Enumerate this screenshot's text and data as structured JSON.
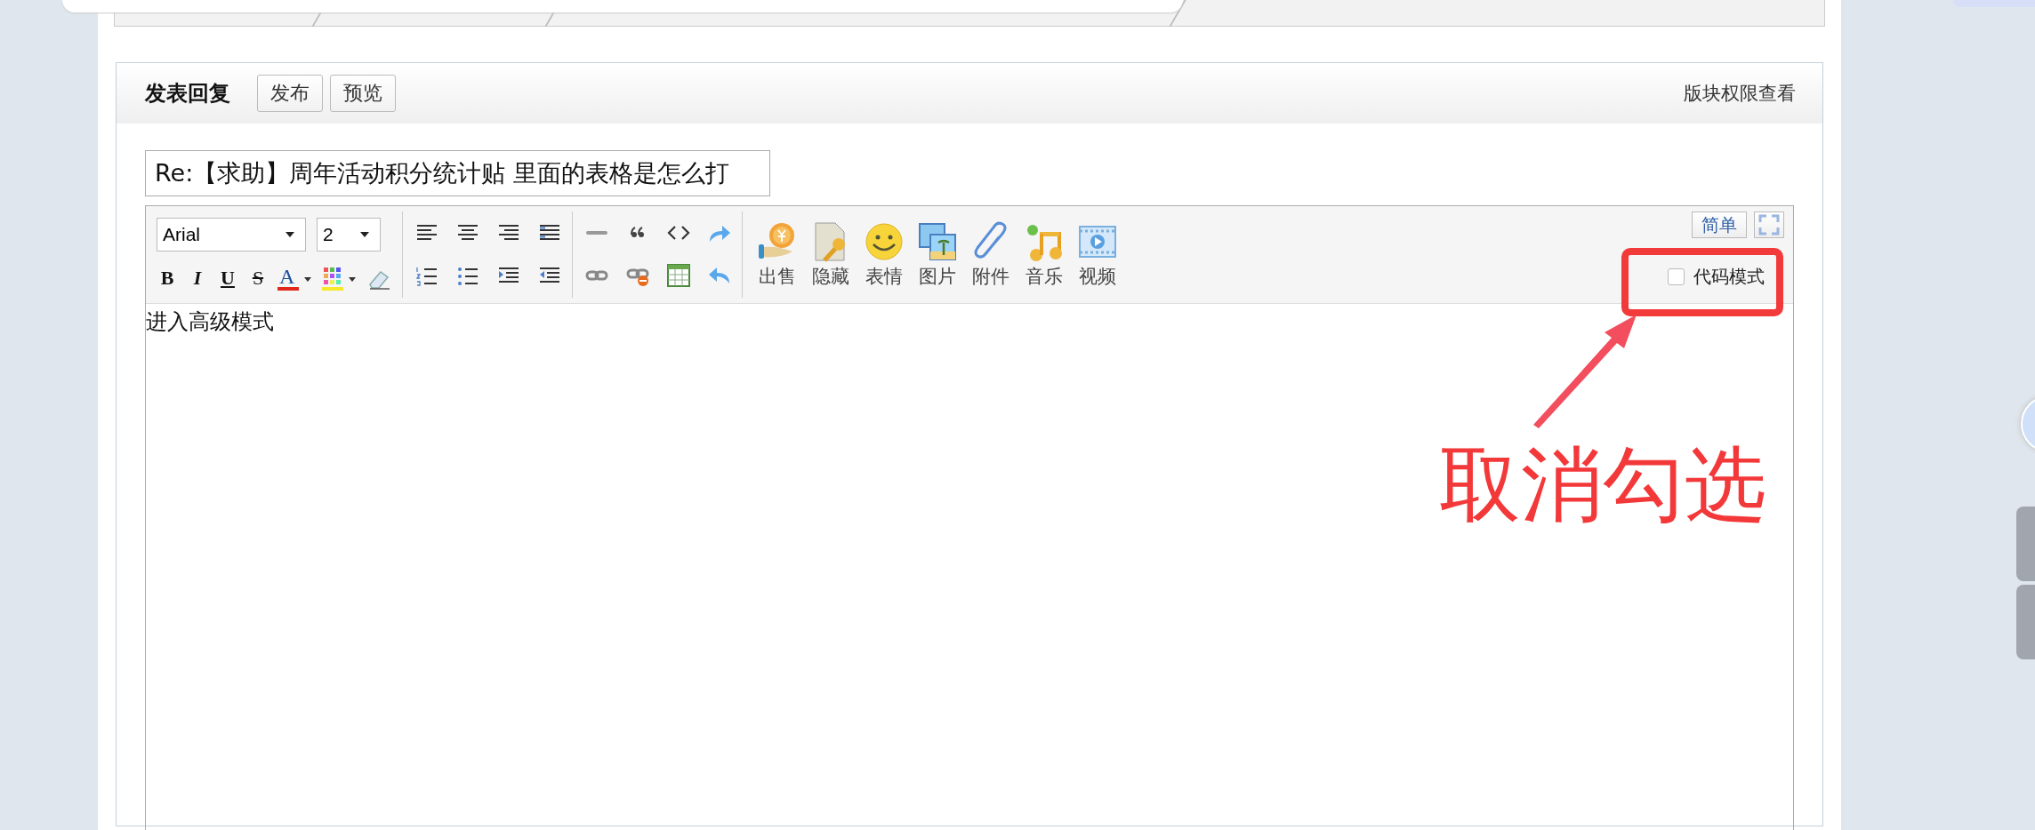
{
  "header": {
    "title": "发表回复",
    "buttons": [
      "发布",
      "预览"
    ],
    "link": "版块权限查看"
  },
  "subject": {
    "value": "Re:【求助】周年活动积分统计贴 里面的表格是怎么打"
  },
  "toolbar": {
    "font": "Arial",
    "size": "2",
    "format_buttons": [
      "B",
      "I",
      "U",
      "S"
    ],
    "font_color": "A",
    "media_buttons": [
      "出售",
      "隐藏",
      "表情",
      "图片",
      "附件",
      "音乐",
      "视频"
    ],
    "mode_button": "简单",
    "code_mode": {
      "label": "代码模式",
      "checked": false
    }
  },
  "editor": {
    "content": "进入高级模式"
  },
  "annotation": {
    "text": "取消勾选"
  }
}
